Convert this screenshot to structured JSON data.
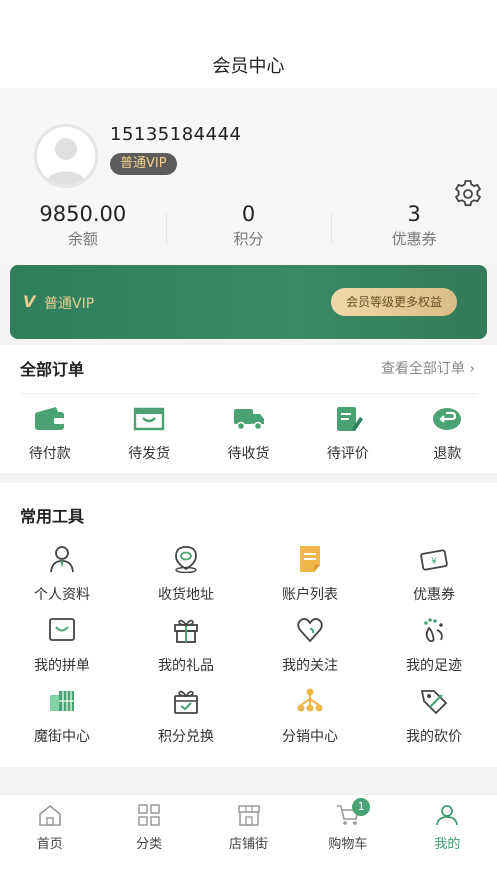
{
  "header": {
    "title": "会员中心"
  },
  "profile": {
    "phone": "15135184444",
    "vip_level": "普通VIP",
    "stats": [
      {
        "value": "9850.00",
        "label": "余额"
      },
      {
        "value": "0",
        "label": "积分"
      },
      {
        "value": "3",
        "label": "优惠券"
      }
    ]
  },
  "vip_card": {
    "logo": "V",
    "level": "普通VIP",
    "button": "会员等级更多权益"
  },
  "orders": {
    "title": "全部订单",
    "view_all": "查看全部订单 ›",
    "items": [
      {
        "label": "待付款",
        "icon": "wallet-icon"
      },
      {
        "label": "待发货",
        "icon": "bag-icon"
      },
      {
        "label": "待收货",
        "icon": "truck-icon"
      },
      {
        "label": "待评价",
        "icon": "review-icon"
      },
      {
        "label": "退款",
        "icon": "refund-icon"
      }
    ]
  },
  "tools": {
    "title": "常用工具",
    "rows": [
      [
        {
          "label": "个人资料",
          "icon": "user-profile-icon"
        },
        {
          "label": "收货地址",
          "icon": "location-icon"
        },
        {
          "label": "账户列表",
          "icon": "account-list-icon"
        },
        {
          "label": "优惠券",
          "icon": "coupon-icon"
        }
      ],
      [
        {
          "label": "我的拼单",
          "icon": "group-buy-icon"
        },
        {
          "label": "我的礼品",
          "icon": "gift-icon"
        },
        {
          "label": "我的关注",
          "icon": "heart-icon"
        },
        {
          "label": "我的足迹",
          "icon": "footprint-icon"
        }
      ],
      [
        {
          "label": "魔街中心",
          "icon": "building-icon"
        },
        {
          "label": "积分兑换",
          "icon": "exchange-gift-icon"
        },
        {
          "label": "分销中心",
          "icon": "distribution-icon"
        },
        {
          "label": "我的砍价",
          "icon": "bargain-tag-icon"
        }
      ]
    ]
  },
  "tabbar": {
    "items": [
      {
        "label": "首页",
        "icon": "home-icon"
      },
      {
        "label": "分类",
        "icon": "category-icon"
      },
      {
        "label": "店铺街",
        "icon": "store-icon"
      },
      {
        "label": "购物车",
        "icon": "cart-icon",
        "badge": "1"
      },
      {
        "label": "我的",
        "icon": "me-icon",
        "active": true
      }
    ]
  },
  "colors": {
    "accent": "#3e9b6f",
    "card": "#2f7f5c",
    "gold": "#e8cf8e",
    "badge": "#4aa172"
  }
}
